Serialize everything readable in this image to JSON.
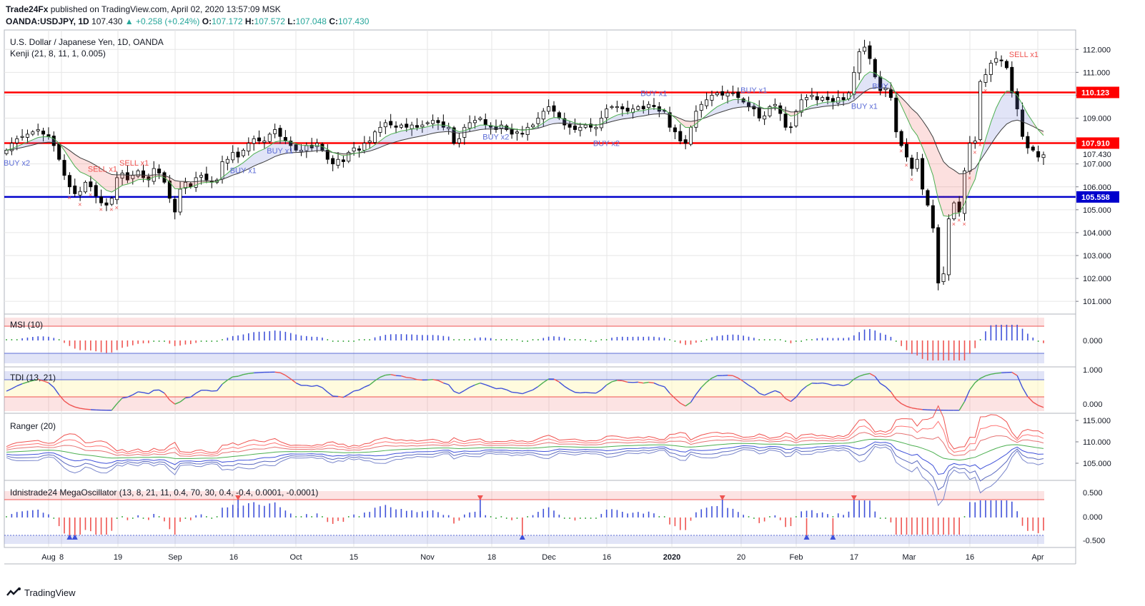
{
  "header": {
    "author": "Trade24Fx",
    "published_text": "published on TradingView.com, April 02, 2020 13:57:09 MSK",
    "symbol": "OANDA:USDJPY, 1D",
    "last": "107.430",
    "change_arrow": "▲",
    "change": "+0.258 (+0.24%)",
    "o_label": "O:",
    "o_value": "107.172",
    "h_label": "H:",
    "h_value": "107.572",
    "l_label": "L:",
    "l_value": "107.048",
    "c_label": "C:",
    "c_value": "107.430"
  },
  "main_pane": {
    "title": "U.S. Dollar / Japanese Yen, 1D, OANDA",
    "indicator": "Kenji (21, 8, 11, 1, 0.005)",
    "price_ticks": [
      "112.000",
      "111.000",
      "110.000",
      "109.000",
      "108.000",
      "107.000",
      "106.000",
      "105.000",
      "104.000",
      "103.000",
      "102.000",
      "101.000"
    ],
    "level_upper_red": "110.123",
    "level_mid_red": "107.910",
    "last_price_label": "107.430",
    "level_blue": "105.558",
    "signals": [
      {
        "text": "BUY x2",
        "color": "#5b6bd6"
      },
      {
        "text": "SELL x1",
        "color": "#ef5350"
      },
      {
        "text": "SELL x1",
        "color": "#ef5350"
      },
      {
        "text": "BUY x1",
        "color": "#5b6bd6"
      },
      {
        "text": "BUY x1",
        "color": "#5b6bd6"
      },
      {
        "text": "BUY x2",
        "color": "#5b6bd6"
      },
      {
        "text": "BUY x2",
        "color": "#5b6bd6"
      },
      {
        "text": "BUY x1",
        "color": "#5b6bd6"
      },
      {
        "text": "BUY x1",
        "color": "#5b6bd6"
      },
      {
        "text": "BUY x1",
        "color": "#5b6bd6"
      },
      {
        "text": "BUY",
        "color": "#5b6bd6"
      },
      {
        "text": "SELL x1",
        "color": "#ef5350"
      }
    ]
  },
  "panes": {
    "msi": {
      "title": "MSI (10)",
      "ticks": [
        "0.000"
      ]
    },
    "tdi": {
      "title": "TDI (13, 21)",
      "ticks": [
        "1.000",
        "0.000"
      ]
    },
    "ranger": {
      "title": "Ranger (20)",
      "ticks": [
        "115.000",
        "110.000",
        "105.000"
      ]
    },
    "mega": {
      "title": "Idnistrade24 MegaOscillator (13, 8, 21, 11, 0.4, 70, 30, 0.4, -0.4, 0.0001, -0.0001)",
      "ticks": [
        "0.500",
        "0.000",
        "-0.500"
      ]
    }
  },
  "x_axis": [
    "Aug",
    "8",
    "19",
    "Sep",
    "16",
    "Oct",
    "15",
    "Nov",
    "18",
    "Dec",
    "16",
    "2020",
    "20",
    "Feb",
    "17",
    "Mar",
    "16",
    "Apr"
  ],
  "footer": {
    "brand": "TradingView"
  },
  "colors": {
    "bull": "#ffffff",
    "bear": "#000000",
    "red_level": "#ff0000",
    "blue_level": "#0000cc",
    "buy": "#5b6bd6",
    "sell": "#ef5350",
    "grid": "#e6e6e6"
  },
  "chart_data": {
    "type": "candlestick",
    "timeframe": "1D",
    "ylim": [
      100.6,
      112.6
    ],
    "levels": [
      110.123,
      107.91,
      105.558
    ],
    "close_path": [
      107.6,
      107.9,
      108.1,
      108.2,
      108.3,
      108.4,
      108.5,
      108.3,
      108.2,
      107.8,
      107.2,
      106.5,
      106.0,
      105.7,
      105.8,
      106.2,
      106.0,
      105.6,
      105.3,
      105.2,
      105.5,
      106.4,
      106.6,
      106.3,
      106.5,
      106.7,
      106.4,
      106.3,
      106.8,
      106.6,
      106.2,
      105.5,
      104.9,
      105.9,
      106.2,
      106.0,
      106.4,
      106.5,
      106.3,
      106.2,
      106.3,
      107.1,
      107.2,
      107.5,
      107.3,
      107.6,
      107.9,
      108.1,
      108.0,
      108.0,
      108.3,
      108.5,
      108.2,
      108.0,
      107.8,
      107.6,
      107.6,
      107.8,
      107.7,
      107.9,
      107.6,
      107.2,
      107.0,
      107.2,
      107.1,
      107.5,
      107.7,
      107.6,
      107.9,
      108.0,
      108.4,
      108.6,
      108.8,
      108.7,
      108.6,
      108.7,
      108.6,
      108.7,
      108.6,
      108.7,
      108.8,
      108.9,
      108.8,
      108.6,
      108.6,
      107.9,
      108.1,
      108.6,
      108.8,
      108.9,
      109.0,
      108.7,
      108.6,
      108.5,
      108.7,
      108.5,
      108.3,
      108.4,
      108.3,
      108.6,
      108.7,
      109.0,
      109.3,
      109.5,
      109.3,
      109.0,
      108.7,
      108.6,
      108.5,
      108.6,
      108.7,
      108.6,
      108.6,
      109.0,
      109.4,
      109.5,
      109.5,
      109.4,
      109.3,
      109.4,
      109.5,
      109.4,
      109.6,
      109.5,
      109.3,
      109.3,
      108.6,
      108.4,
      108.0,
      107.9,
      108.6,
      109.3,
      109.6,
      109.8,
      110.0,
      110.1,
      110.0,
      110.1,
      110.1,
      109.9,
      109.7,
      109.5,
      109.4,
      109.0,
      109.1,
      109.5,
      109.6,
      109.2,
      108.6,
      108.6,
      109.3,
      109.8,
      109.9,
      110.0,
      109.8,
      109.9,
      109.8,
      109.7,
      109.9,
      109.8,
      110.1,
      111.0,
      111.9,
      112.1,
      111.6,
      110.8,
      110.2,
      110.3,
      109.9,
      108.4,
      107.8,
      107.3,
      106.8,
      107.2,
      105.9,
      105.2,
      104.2,
      101.8,
      102.2,
      104.6,
      105.3,
      104.9,
      106.7,
      107.9,
      108.0,
      110.6,
      110.9,
      111.4,
      111.6,
      111.5,
      111.2,
      110.1,
      109.4,
      108.2,
      107.7,
      107.6,
      107.3,
      107.4
    ]
  }
}
